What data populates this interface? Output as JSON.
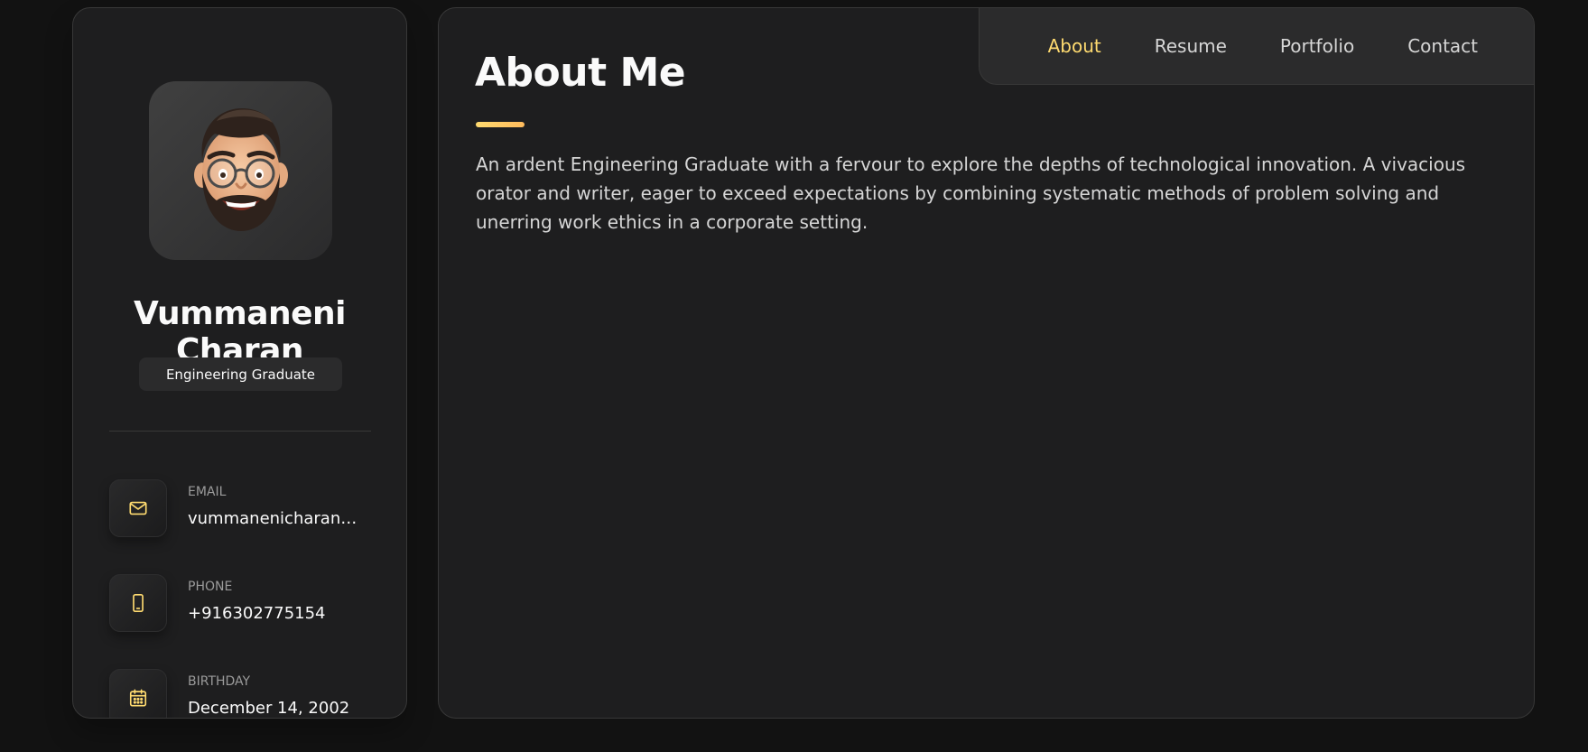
{
  "sidebar": {
    "avatar_alt": "Avatar",
    "name": "Vummaneni Charan",
    "title": "Engineering Graduate",
    "contacts": [
      {
        "label": "Email",
        "value": "vummanenicharan@gmail.com",
        "icon": "mail-icon"
      },
      {
        "label": "Phone",
        "value": "+916302775154",
        "icon": "phone-icon"
      },
      {
        "label": "Birthday",
        "value": "December 14, 2002",
        "icon": "calendar-icon"
      }
    ]
  },
  "navbar": {
    "links": [
      {
        "label": "About",
        "active": true
      },
      {
        "label": "Resume",
        "active": false
      },
      {
        "label": "Portfolio",
        "active": false
      },
      {
        "label": "Contact",
        "active": false
      }
    ]
  },
  "about": {
    "title": "About Me",
    "text": "An ardent Engineering Graduate with a fervour to explore the depths of technological innovation. A vivacious orator and writer, eager to exceed expectations by combining systematic methods of problem solving and unerring work ethics in a corporate setting."
  },
  "colors": {
    "accent": "#ffdb70",
    "background": "#121212",
    "card": "#1e1e1f",
    "border": "#383838"
  }
}
